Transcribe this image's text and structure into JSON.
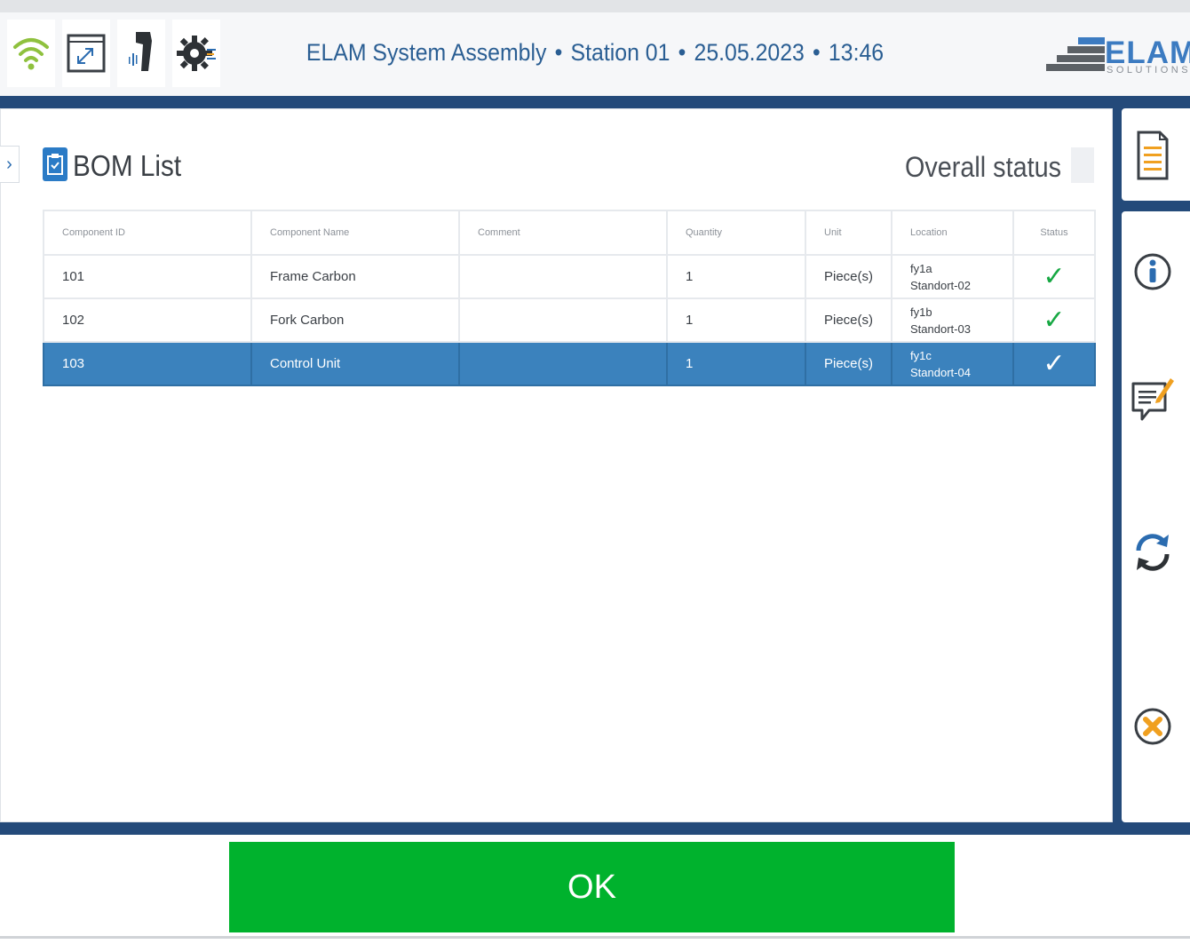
{
  "header": {
    "app_name": "ELAM System Assembly",
    "separator": "•",
    "station": "Station 01",
    "date": "25.05.2023",
    "time": "13:46",
    "logo_text": "ELAM",
    "logo_sub": "SOLUTIONS",
    "icons": [
      "wifi-icon",
      "fullscreen-icon",
      "barcode-scanner-icon",
      "settings-icon"
    ]
  },
  "panel": {
    "title": "BOM List",
    "overall_status_label": "Overall status",
    "collapse_glyph": "›"
  },
  "table": {
    "columns": [
      "Component ID",
      "Component Name",
      "Comment",
      "Quantity",
      "Unit",
      "Location",
      "Status"
    ],
    "rows": [
      {
        "id": "101",
        "name": "Frame Carbon",
        "comment": "",
        "quantity": "1",
        "unit": "Piece(s)",
        "location_line1": "fy1a",
        "location_line2": "Standort-02",
        "status": "✓"
      },
      {
        "id": "102",
        "name": "Fork Carbon",
        "comment": "",
        "quantity": "1",
        "unit": "Piece(s)",
        "location_line1": "fy1b",
        "location_line2": "Standort-03",
        "status": "✓"
      },
      {
        "id": "103",
        "name": "Control Unit",
        "comment": "",
        "quantity": "1",
        "unit": "Piece(s)",
        "location_line1": "fy1c",
        "location_line2": "Standort-04",
        "status": "✓"
      }
    ],
    "selected_row": 2
  },
  "sidebar": {
    "buttons": [
      "document-icon",
      "info-icon",
      "comment-edit-icon",
      "refresh-icon",
      "cancel-icon"
    ]
  },
  "footer": {
    "ok_label": "OK"
  },
  "colors": {
    "accent_blue": "#244a7a",
    "selected_row": "#3b82bd",
    "ok_green": "#00b22d",
    "check_green": "#17a843",
    "title_blue": "#2a5e93"
  }
}
